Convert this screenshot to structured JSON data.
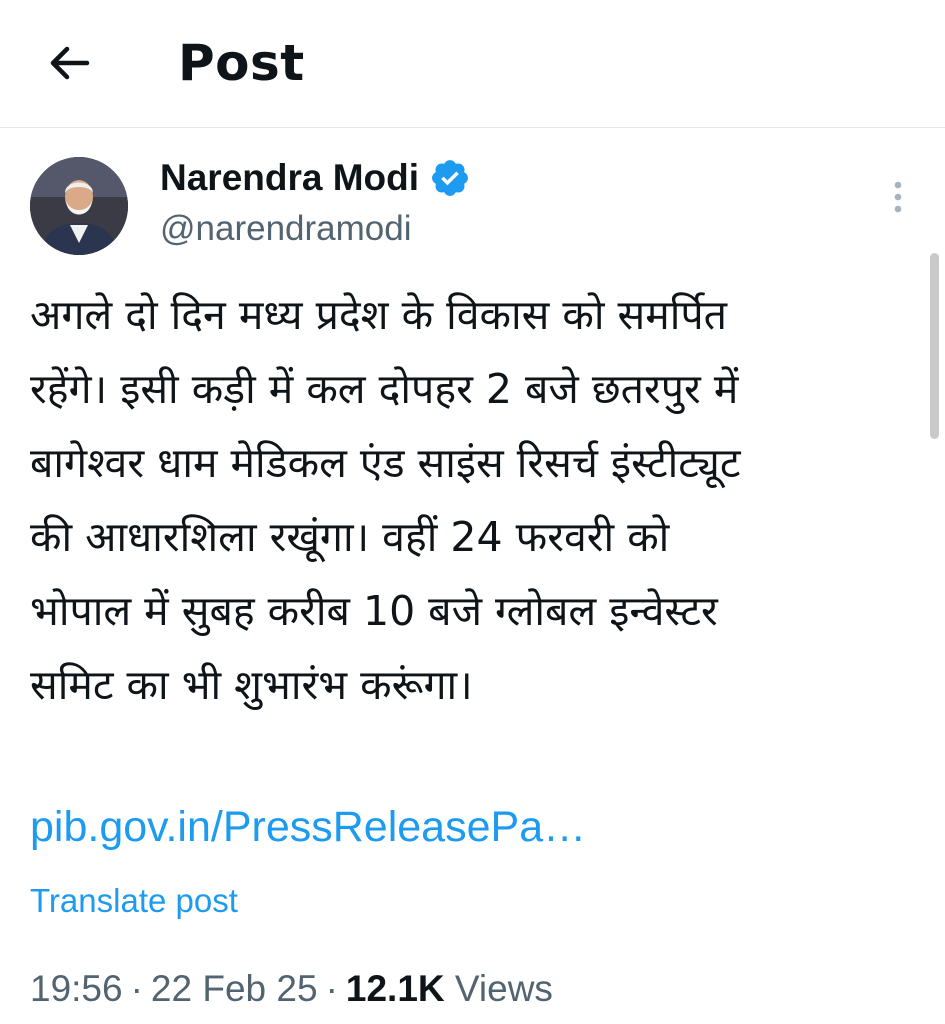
{
  "header": {
    "back_icon": "arrow-left-icon",
    "title": "Post"
  },
  "author": {
    "name": "Narendra Modi",
    "handle": "@narendramodi",
    "verified_icon": "verified-badge-icon",
    "verified_color": "#1d9bf0"
  },
  "more_icon": "more-vertical-icon",
  "post": {
    "lines": [
      "अगले दो दिन मध्य प्रदेश के विकास को समर्पित",
      "रहेंगे। इसी कड़ी में कल दोपहर 2 बजे छतरपुर में",
      "बागेश्वर धाम मेडिकल एंड साइंस रिसर्च इंस्टीट्यूट",
      "की आधारशिला रखूंगा। वहीं 24 फरवरी को",
      "भोपाल में सुबह करीब 10 बजे ग्लोबल इन्वेस्टर",
      "समिट का भी शुभारंभ करूंगा।"
    ],
    "link": "pib.gov.in/PressReleasePa…",
    "translate_label": "Translate post"
  },
  "meta": {
    "time": "19:56",
    "separator": "·",
    "date": "22 Feb 25",
    "views_count": "12.1K",
    "views_label": "Views"
  },
  "colors": {
    "link": "#1d9bf0",
    "secondary_text": "#536471",
    "primary_text": "#0f1419"
  }
}
